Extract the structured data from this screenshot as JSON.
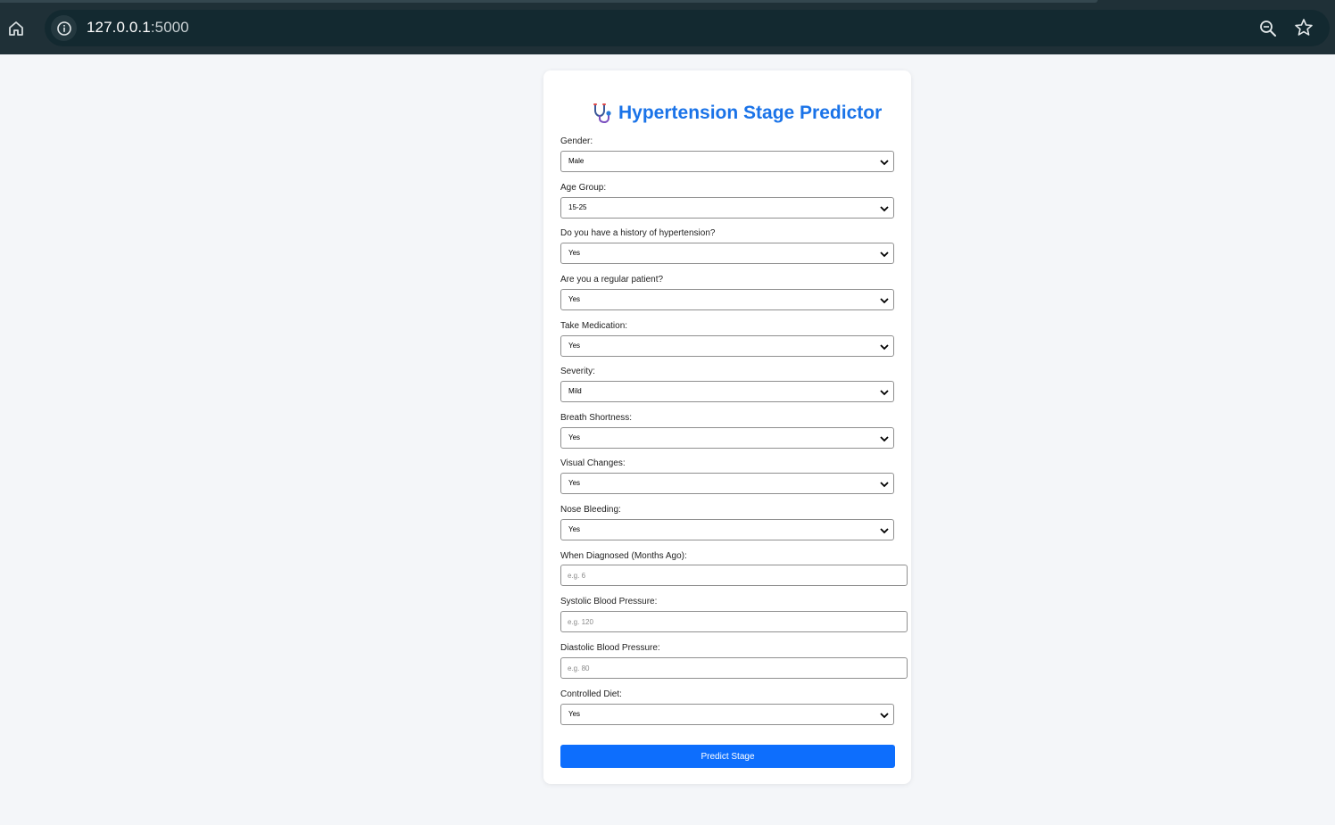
{
  "browser": {
    "url_host": "127.0.0.1",
    "url_port": ":5000"
  },
  "page": {
    "title": "Hypertension Stage Predictor",
    "title_icon": "stethoscope-icon",
    "accent_color": "#1a73e8",
    "button_color": "#0d6efd"
  },
  "form": {
    "gender": {
      "label": "Gender:",
      "value": "Male"
    },
    "age_group": {
      "label": "Age Group:",
      "value": "15-25"
    },
    "history": {
      "label": "Do you have a history of hypertension?",
      "value": "Yes"
    },
    "regular_patient": {
      "label": "Are you a regular patient?",
      "value": "Yes"
    },
    "medication": {
      "label": "Take Medication:",
      "value": "Yes"
    },
    "severity": {
      "label": "Severity:",
      "value": "Mild"
    },
    "breath_shortness": {
      "label": "Breath Shortness:",
      "value": "Yes"
    },
    "visual_changes": {
      "label": "Visual Changes:",
      "value": "Yes"
    },
    "nose_bleeding": {
      "label": "Nose Bleeding:",
      "value": "Yes"
    },
    "when_diagnosed": {
      "label": "When Diagnosed (Months Ago):",
      "placeholder": "e.g. 6"
    },
    "systolic": {
      "label": "Systolic Blood Pressure:",
      "placeholder": "e.g. 120"
    },
    "diastolic": {
      "label": "Diastolic Blood Pressure:",
      "placeholder": "e.g. 80"
    },
    "controlled_diet": {
      "label": "Controlled Diet:",
      "value": "Yes"
    },
    "submit_label": "Predict Stage"
  }
}
